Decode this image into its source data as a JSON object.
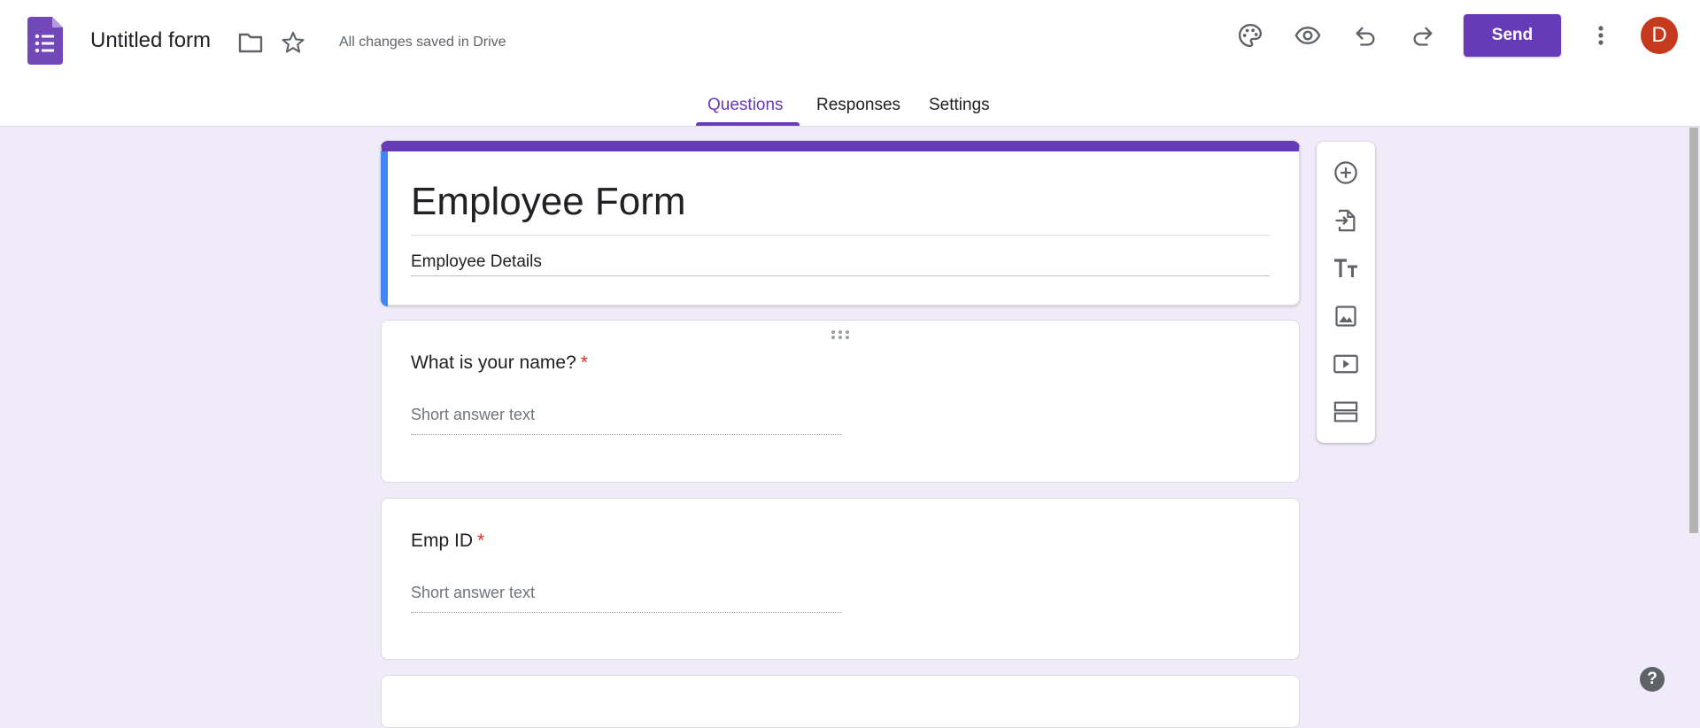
{
  "header": {
    "doc_title": "Untitled form",
    "saved_status": "All changes saved in Drive",
    "send_label": "Send",
    "avatar_letter": "D",
    "icons": [
      "forms-logo-icon",
      "folder-icon",
      "star-icon",
      "palette-icon",
      "preview-eye-icon",
      "undo-icon",
      "redo-icon",
      "more-vert-icon"
    ]
  },
  "tabs": [
    {
      "label": "Questions",
      "active": true
    },
    {
      "label": "Responses",
      "active": false
    },
    {
      "label": "Settings",
      "active": false
    }
  ],
  "form": {
    "title": "Employee Form",
    "description": "Employee Details",
    "questions": [
      {
        "title": "What is your name?",
        "required": "*",
        "answer_placeholder": "Short answer text"
      },
      {
        "title": "Emp ID",
        "required": "*",
        "answer_placeholder": "Short answer text"
      }
    ]
  },
  "toolbar": {
    "items": [
      "add-question-icon",
      "import-questions-icon",
      "add-title-icon",
      "add-image-icon",
      "add-video-icon",
      "add-section-icon"
    ]
  },
  "help_label": "?",
  "colors": {
    "accent": "#673ab7",
    "background": "#f0ebf8",
    "avatar": "#c5391c",
    "title_accent": "#4285f4",
    "required": "#d93025"
  }
}
